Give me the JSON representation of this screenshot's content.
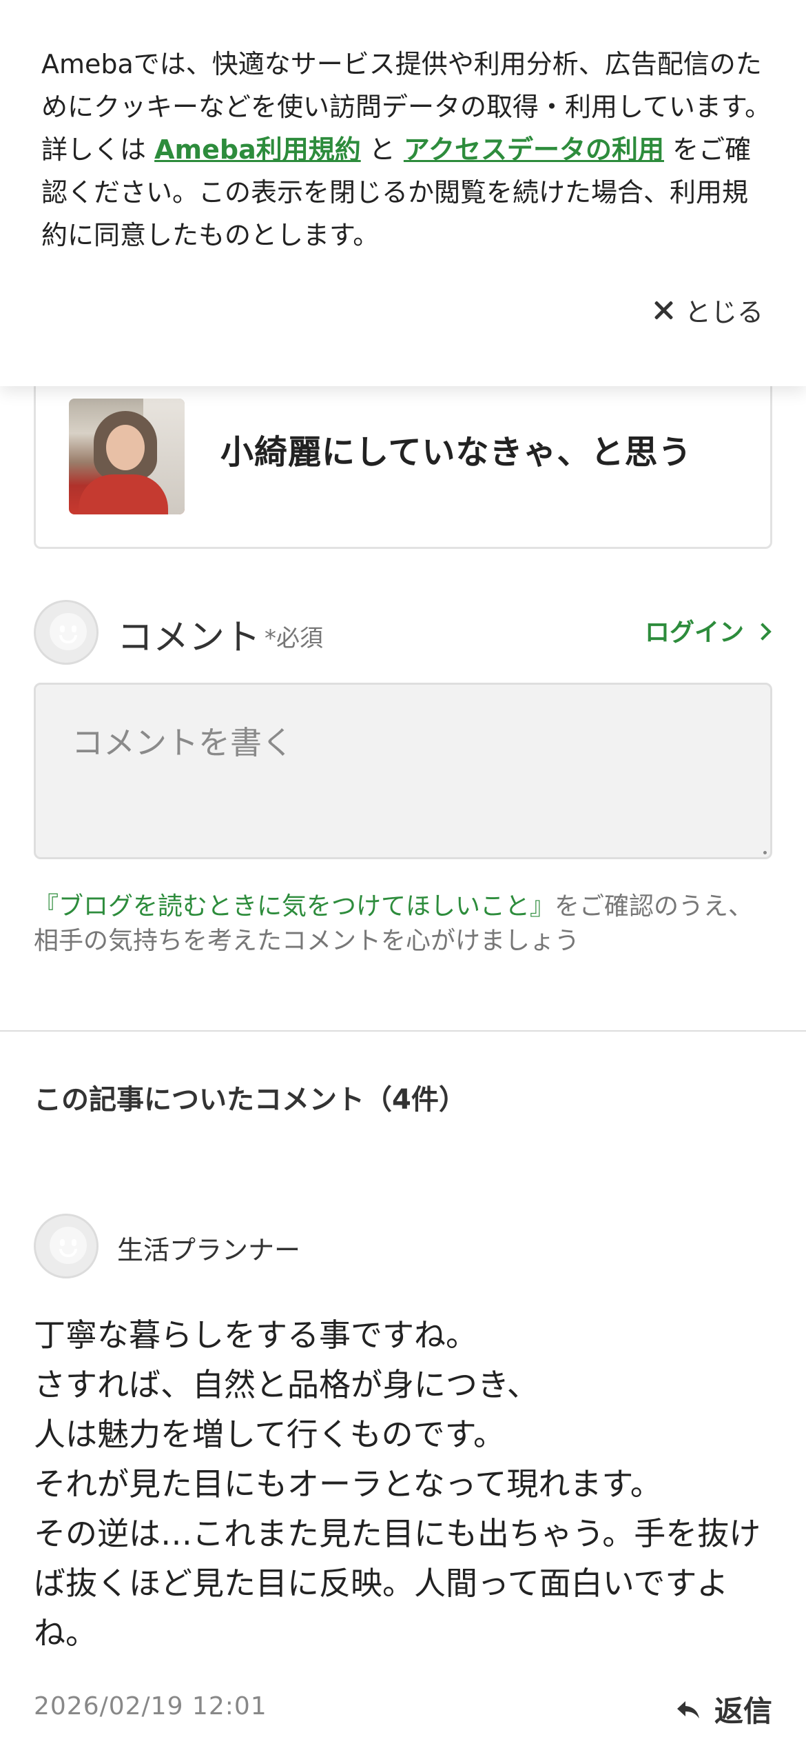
{
  "cookie_banner": {
    "text_part1": "Amebaでは、快適なサービス提供や利用分析、広告配信のためにクッキーなどを使い訪問データの取得・利用しています。詳しくは ",
    "terms_link": "Ameba利用規約",
    "text_part2": " と ",
    "access_link": "アクセスデータの利用",
    "text_part3": " をご確認ください。この表示を閉じるか閲覧を続けた場合、利用規約に同意したものとします。",
    "close_label": "とじる"
  },
  "article_card": {
    "title": "小綺麗にしていなきゃ、と思う"
  },
  "comment_form": {
    "heading": "コメント",
    "required_label": "*必須",
    "login_label": "ログイン",
    "input_placeholder": "コメントを書く",
    "input_value": "",
    "guideline_link": "『ブログを読むときに気をつけてほしいこと』",
    "guideline_text": "をご確認のうえ、相手の気持ちを考えたコメントを心がけましょう"
  },
  "comments_section": {
    "heading": "この記事についたコメント（4件）",
    "comments": [
      {
        "author": "生活プランナー",
        "lines": [
          "丁寧な暮らしをする事ですね。",
          "さすれば、自然と品格が身につき、",
          "人は魅力を増して行くものです。",
          "それが見た目にもオーラとなって現れます。",
          "その逆は…これまた見た目にも出ちゃう。手を抜けば抜くほど見た目に反映。人間って面白いですよね。"
        ],
        "timestamp": "2026/02/19 12:01",
        "reply_label": "返信"
      }
    ]
  },
  "colors": {
    "accent_green": "#2d8c3c",
    "text_main": "#222222",
    "text_muted": "#777777"
  },
  "icons": [
    "close-icon",
    "chevron-right-icon",
    "default-avatar-icon",
    "reply-arrow-icon"
  ]
}
